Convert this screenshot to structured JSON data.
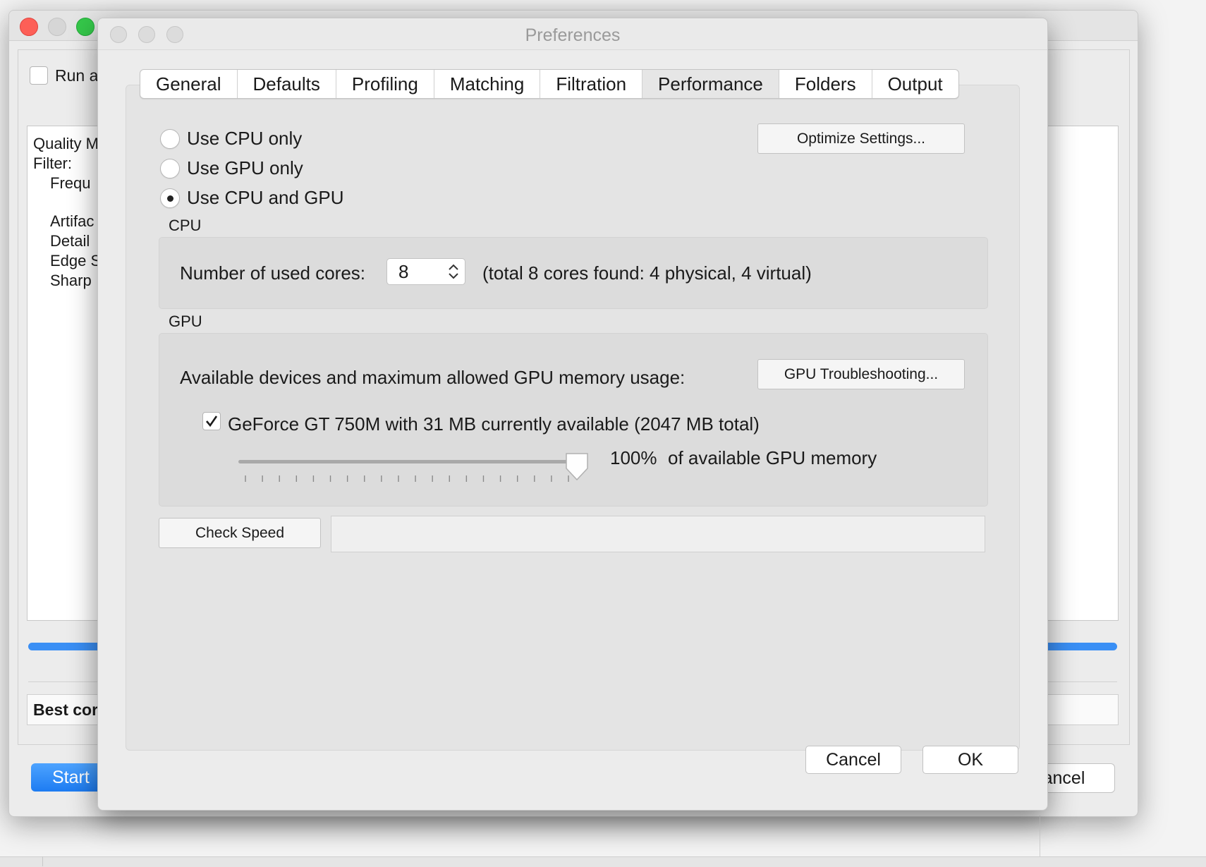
{
  "background_window": {
    "run_checkbox_label": "Run a",
    "list_items": [
      "Quality M",
      "Filter:",
      "Frequ",
      "Artifac",
      "Detail",
      "Edge S",
      "Sharp"
    ],
    "best_label": "Best cor",
    "start_label": "Start",
    "cancel_label": "ancel"
  },
  "dialog": {
    "title": "Preferences",
    "tabs": [
      {
        "label": "General",
        "active": false
      },
      {
        "label": "Defaults",
        "active": false
      },
      {
        "label": "Profiling",
        "active": false
      },
      {
        "label": "Matching",
        "active": false
      },
      {
        "label": "Filtration",
        "active": false
      },
      {
        "label": "Performance",
        "active": true
      },
      {
        "label": "Folders",
        "active": false
      },
      {
        "label": "Output",
        "active": false
      }
    ],
    "mode_options": [
      {
        "label": "Use CPU only",
        "checked": false
      },
      {
        "label": "Use GPU only",
        "checked": false
      },
      {
        "label": "Use CPU and GPU",
        "checked": true
      }
    ],
    "optimize_label": "Optimize Settings...",
    "cpu": {
      "section_label": "CPU",
      "cores_label": "Number of used cores:",
      "cores_value": "8",
      "cores_info": "(total 8 cores found: 4 physical, 4 virtual)"
    },
    "gpu": {
      "section_label": "GPU",
      "devices_label": "Available devices and maximum allowed GPU memory usage:",
      "troubleshoot_label": "GPU Troubleshooting...",
      "device_label": "GeForce GT 750M with 31 MB currently available (2047 MB total)",
      "device_checked": true,
      "memory_percent_label": "100%",
      "memory_suffix": "of available GPU memory",
      "slider_value_fraction": 1.0
    },
    "check_speed_label": "Check Speed",
    "check_speed_result": "",
    "cancel_label": "Cancel",
    "ok_label": "OK"
  }
}
